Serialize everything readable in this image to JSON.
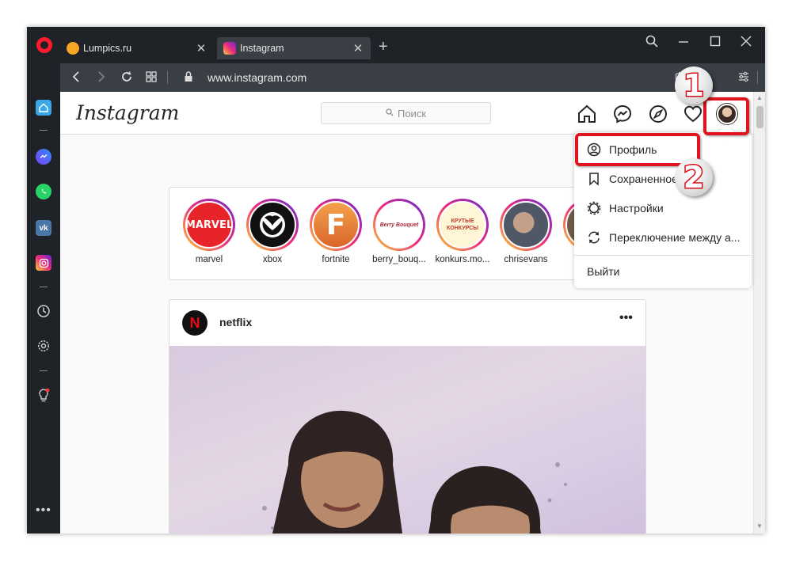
{
  "browser": {
    "tabs": [
      {
        "title": "Lumpics.ru",
        "active": false
      },
      {
        "title": "Instagram",
        "active": true
      }
    ],
    "url": "www.instagram.com",
    "accent": "#ff1b2d"
  },
  "instagram": {
    "logo": "Instagram",
    "search_placeholder": "Поиск",
    "stories": [
      {
        "name": "marvel"
      },
      {
        "name": "xbox"
      },
      {
        "name": "fortnite"
      },
      {
        "name": "berry_bouq..."
      },
      {
        "name": "konkurs.mo..."
      },
      {
        "name": "chrisevans"
      }
    ],
    "story_logos": {
      "marvel": "MARVEL",
      "fortnite": "F",
      "berry": "Berry Bouquet",
      "konkurs": "КРУТЫЕ КОНКУРСЫ"
    },
    "post": {
      "username": "netflix",
      "avatar_letter": "N",
      "more": "•••"
    },
    "menu": {
      "items": [
        {
          "label": "Профиль",
          "icon": "profile-icon"
        },
        {
          "label": "Сохраненное",
          "icon": "bookmark-icon"
        },
        {
          "label": "Настройки",
          "icon": "settings-icon"
        },
        {
          "label": "Переключение между а...",
          "icon": "switch-account-icon"
        }
      ],
      "logout": "Выйти"
    }
  },
  "callouts": {
    "first": "1",
    "second": "2",
    "color": "#e0141e"
  }
}
